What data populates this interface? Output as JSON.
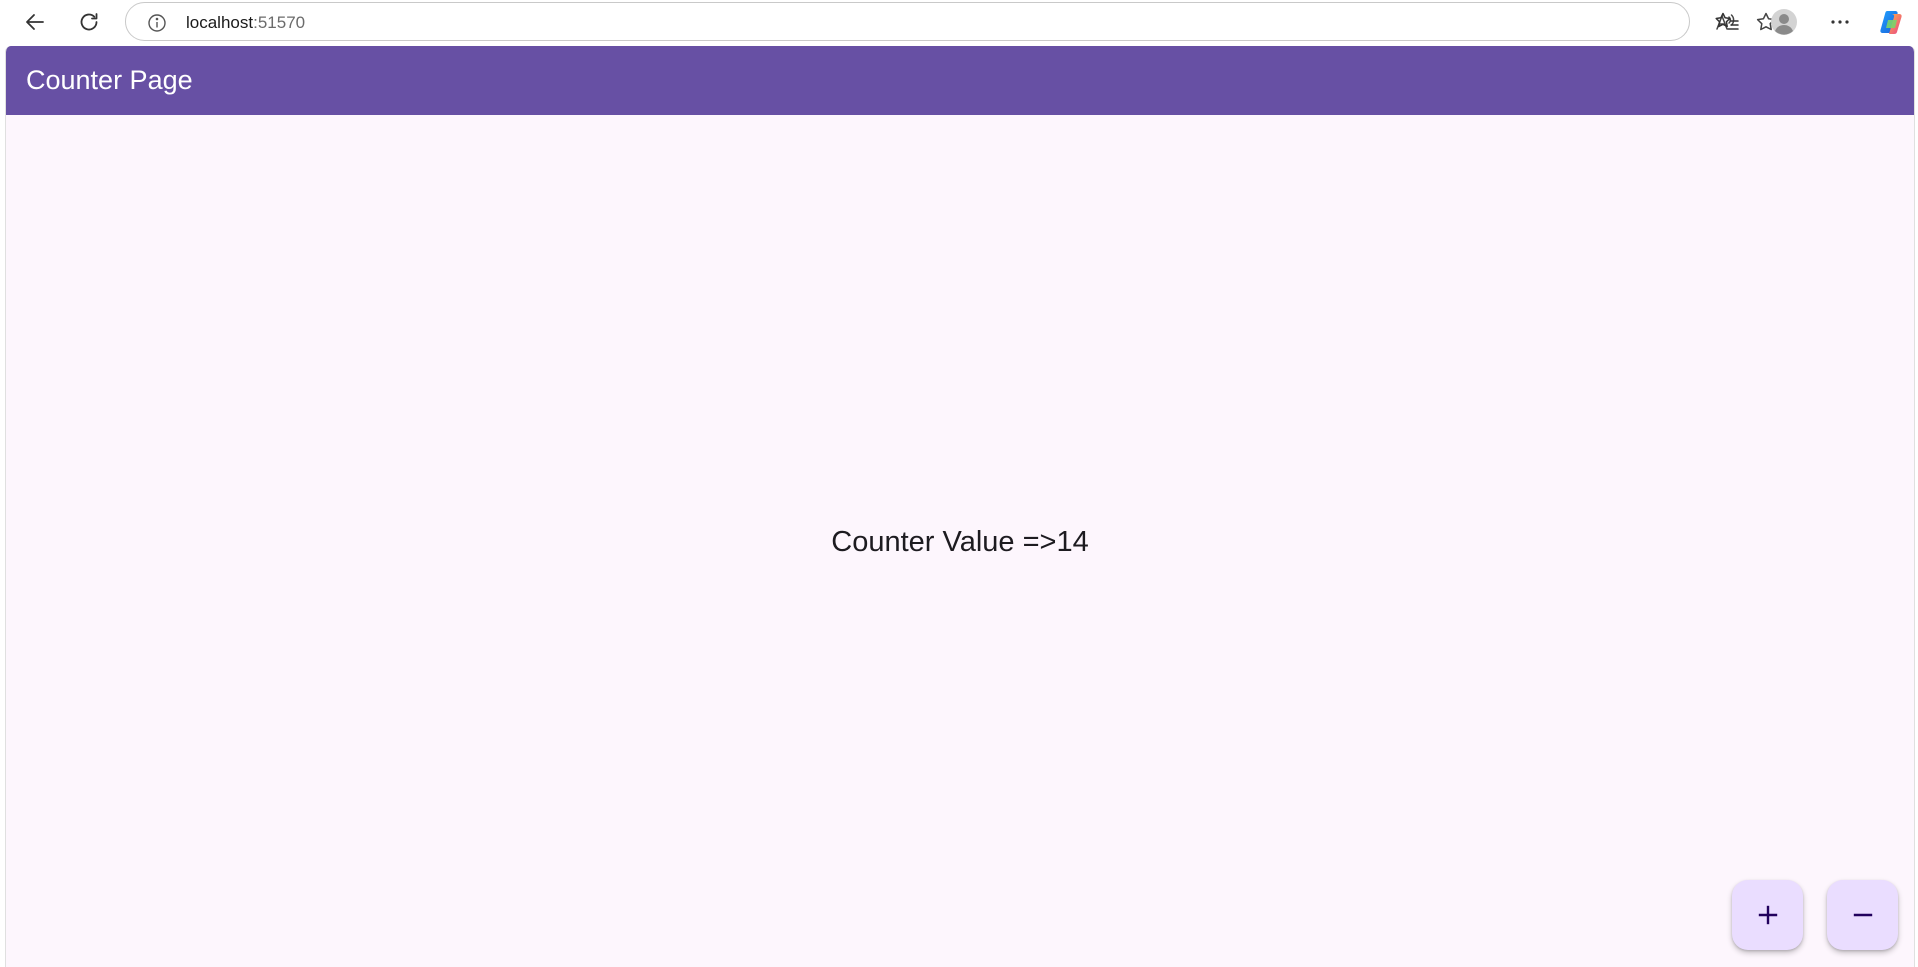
{
  "browser": {
    "url_host": "localhost",
    "url_port": ":51570",
    "icons": {
      "back": "back-arrow-icon",
      "refresh": "refresh-icon",
      "site_info": "info-icon",
      "read_aloud": "read-aloud-icon",
      "favorite": "star-icon",
      "favorites_list": "favorites-list-icon",
      "profile": "profile-icon",
      "more": "more-options-icon",
      "copilot": "copilot-icon"
    }
  },
  "app": {
    "title": "Counter Page",
    "counter_text": "Counter Value =>14",
    "colors": {
      "app_bar": "#6750a4",
      "background": "#fdf6fd",
      "fab": "#eaddff",
      "fab_icon": "#21005d"
    },
    "fab_increment_icon": "plus-icon",
    "fab_decrement_icon": "minus-icon"
  }
}
